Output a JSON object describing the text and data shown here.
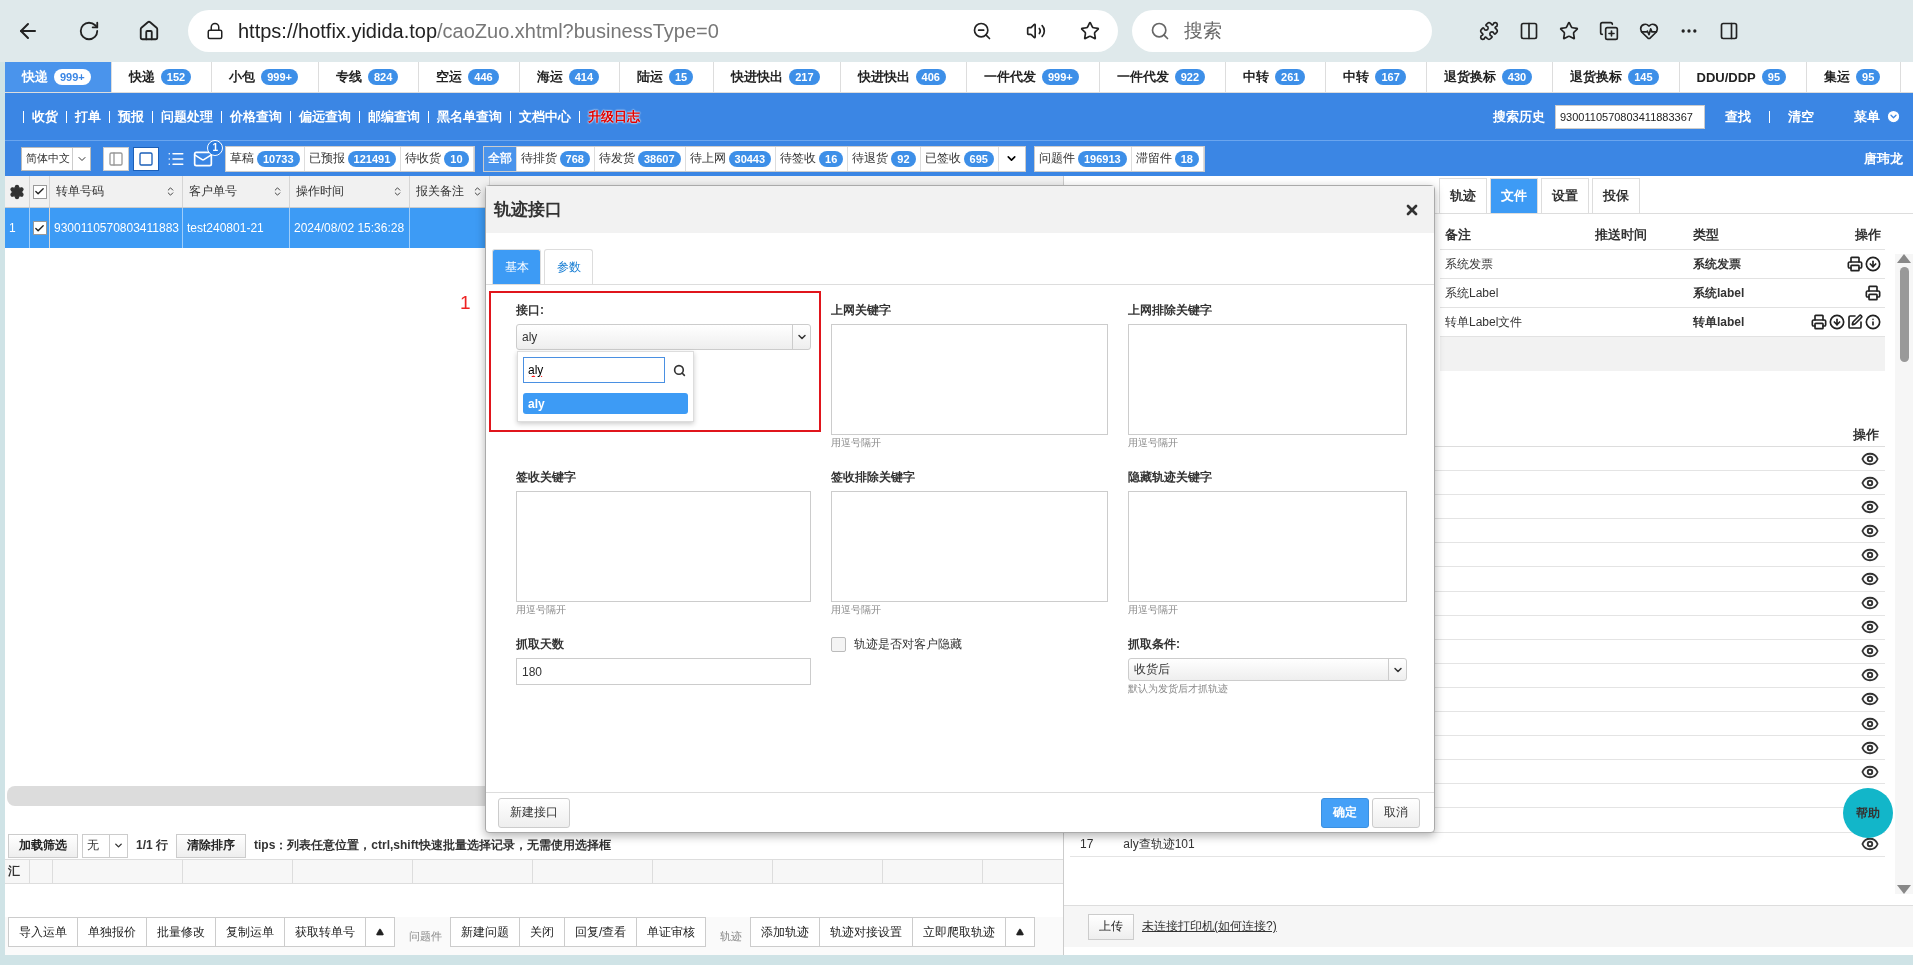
{
  "browser": {
    "url_host": "https://hotfix.yidida.top",
    "url_path": "/caoZuo.xhtml?businessType=0",
    "search_placeholder": "搜索"
  },
  "module_tabs": [
    {
      "label": "快递",
      "count": "999+",
      "selected": true
    },
    {
      "label": "快递",
      "count": "152",
      "selected": false
    },
    {
      "label": "小包",
      "count": "999+",
      "selected": false
    },
    {
      "label": "专线",
      "count": "824",
      "selected": false
    },
    {
      "label": "空运",
      "count": "446",
      "selected": false
    },
    {
      "label": "海运",
      "count": "414",
      "selected": false
    },
    {
      "label": "陆运",
      "count": "15",
      "selected": false
    },
    {
      "label": "快进快出",
      "count": "217",
      "selected": false
    },
    {
      "label": "快进快出",
      "count": "406",
      "selected": false
    },
    {
      "label": "一件代发",
      "count": "999+",
      "selected": false
    },
    {
      "label": "一件代发",
      "count": "922",
      "selected": false
    },
    {
      "label": "中转",
      "count": "261",
      "selected": false
    },
    {
      "label": "中转",
      "count": "167",
      "selected": false
    },
    {
      "label": "退货换标",
      "count": "430",
      "selected": false
    },
    {
      "label": "退货换标",
      "count": "145",
      "selected": false
    },
    {
      "label": "DDU/DDP",
      "count": "95",
      "selected": false
    },
    {
      "label": "集运",
      "count": "95",
      "selected": false
    }
  ],
  "nav": {
    "links": [
      {
        "label": "收货",
        "highlight": false
      },
      {
        "label": "打单",
        "highlight": false
      },
      {
        "label": "预报",
        "highlight": false
      },
      {
        "label": "问题处理",
        "highlight": false
      },
      {
        "label": "价格查询",
        "highlight": false
      },
      {
        "label": "偏远查询",
        "highlight": false
      },
      {
        "label": "邮编查询",
        "highlight": false
      },
      {
        "label": "黑名单查询",
        "highlight": false
      },
      {
        "label": "文档中心",
        "highlight": false
      },
      {
        "label": "升级日志",
        "highlight": true
      }
    ],
    "history_label": "搜索历史",
    "search_value": "9300110570803411883367",
    "find": "查找",
    "clear": "清空",
    "menu": "菜单"
  },
  "toolbar": {
    "language": "简体中文",
    "layout_options": [
      {
        "selected": false
      },
      {
        "selected": true
      }
    ],
    "mail_badge": "1",
    "status_groups": [
      {
        "menu": false,
        "items": [
          {
            "label": "草稿",
            "count": "10733",
            "selected": false
          },
          {
            "label": "已预报",
            "count": "121491",
            "selected": false
          },
          {
            "label": "待收货",
            "count": "10",
            "selected": false
          }
        ]
      },
      {
        "menu": true,
        "items": [
          {
            "label": "全部",
            "selected": true
          },
          {
            "label": "待排货",
            "count": "768",
            "selected": false
          },
          {
            "label": "待发货",
            "count": "38607",
            "selected": false
          },
          {
            "label": "待上网",
            "count": "30443",
            "selected": false
          },
          {
            "label": "待签收",
            "count": "16",
            "selected": false
          },
          {
            "label": "待退货",
            "count": "92",
            "selected": false
          },
          {
            "label": "已签收",
            "count": "695",
            "selected": false
          }
        ]
      },
      {
        "menu": false,
        "items": [
          {
            "label": "问题件",
            "count": "196913",
            "selected": false
          },
          {
            "label": "滞留件",
            "count": "18",
            "selected": false
          }
        ]
      }
    ],
    "user": "唐玮龙"
  },
  "grid": {
    "all_checked": true,
    "columns": [
      "转单号码",
      "客户单号",
      "操作时间",
      "报关备注"
    ],
    "rows": [
      {
        "no": "1",
        "checked": true,
        "selected": true,
        "cells": [
          "9300110570803411883",
          "test240801-21",
          "2024/08/02 15:36:28"
        ]
      }
    ]
  },
  "filter_bar": {
    "load_filter": "加载筛选",
    "filter_value": "无",
    "row_count": "1/1 行",
    "clear_sort": "清除排序",
    "tips": "tips：列表任意位置，ctrl,shift快速批量选择记录，无需使用选择框"
  },
  "summary": {
    "label": "汇"
  },
  "action_groups": [
    {
      "buttons": [
        "导入运单",
        "单独报价",
        "批量修改",
        "复制运单",
        "获取转单号"
      ],
      "more": true
    },
    {
      "title": "问题件",
      "buttons": [
        "新建问题",
        "关闭",
        "回复/查看",
        "单证审核"
      ],
      "more": false
    },
    {
      "title": "轨迹",
      "buttons": [
        "添加轨迹",
        "轨迹对接设置",
        "立即爬取轨迹"
      ],
      "more": true
    }
  ],
  "right_panel": {
    "tabs": [
      {
        "label": "轨迹",
        "selected": false
      },
      {
        "label": "文件",
        "selected": true
      },
      {
        "label": "设置",
        "selected": false
      },
      {
        "label": "投保",
        "selected": false
      }
    ],
    "files": {
      "columns": [
        "备注",
        "推送时间",
        "类型",
        "操作"
      ],
      "rows": [
        {
          "note": "系统发票",
          "type": "系统发票",
          "actions": [
            {
              "kind": "print"
            },
            {
              "kind": "download"
            }
          ]
        },
        {
          "note": "系统Label",
          "type": "系统label",
          "actions": [
            {
              "kind": "print"
            }
          ]
        },
        {
          "note": "转单Label文件",
          "type": "转单label",
          "actions": [
            {
              "kind": "print"
            },
            {
              "kind": "download"
            },
            {
              "kind": "edit"
            },
            {
              "kind": "info"
            }
          ]
        }
      ]
    },
    "tracks": {
      "action_header": "操作",
      "rows": [
        {
          "kind": "covered"
        },
        {
          "kind": "covered"
        },
        {
          "kind": "covered"
        },
        {
          "kind": "covered"
        },
        {
          "kind": "covered"
        },
        {
          "kind": "covered"
        },
        {
          "kind": "covered"
        },
        {
          "kind": "covered"
        },
        {
          "kind": "covered"
        },
        {
          "kind": "covered"
        },
        {
          "kind": "covered"
        },
        {
          "kind": "covered"
        },
        {
          "kind": "covered"
        },
        {
          "kind": "covered"
        },
        {
          "kind": "blank"
        },
        {
          "kind": "blank"
        },
        {
          "kind": "entry",
          "no": "17",
          "text": "aly查轨迹101"
        }
      ]
    },
    "upload": "上传",
    "printer_link": "未连接打印机(如何连接?)"
  },
  "help": "帮助",
  "annotation": "1",
  "dialog": {
    "title": "轨迹接口",
    "tabs": [
      {
        "label": "基本",
        "selected": true
      },
      {
        "label": "参数",
        "selected": false
      }
    ],
    "interface": {
      "label": "接口:",
      "value": "aly",
      "dropdown_open": true,
      "search": "aly",
      "options": [
        {
          "label": "aly",
          "selected": true
        }
      ]
    },
    "keyword_fields": [
      {
        "label": "上网关键字",
        "hint": "用逗号隔开"
      },
      {
        "label": "上网排除关键字",
        "hint": "用逗号隔开"
      },
      {
        "label": "签收关键字",
        "hint": "用逗号隔开"
      },
      {
        "label": "签收排除关键字",
        "hint": "用逗号隔开"
      },
      {
        "label": "隐藏轨迹关键字",
        "hint": "用逗号隔开"
      }
    ],
    "days": {
      "label": "抓取天数",
      "value": "180"
    },
    "hide_option": {
      "label": "轨迹是否对客户隐藏",
      "checked": false
    },
    "condition": {
      "label": "抓取条件:",
      "value": "收货后",
      "hint": "默认为发货后才抓轨迹"
    },
    "buttons": {
      "new": "新建接口",
      "ok": "确定",
      "cancel": "取消"
    }
  }
}
